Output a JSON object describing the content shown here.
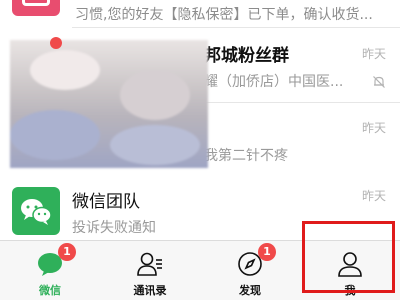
{
  "chats": [
    {
      "title": "",
      "preview": "习惯,您的好友【隐私保密】已下单，确认收货...",
      "time": ""
    },
    {
      "title": "邦城粉丝群",
      "preview": "耀（加侨店）中国医...",
      "time": "昨天",
      "muted": true,
      "icon": "mute-bell-icon"
    },
    {
      "title": "",
      "preview": "我第二针不疼",
      "time": "昨天"
    },
    {
      "title": "微信团队",
      "preview": "投诉失败通知",
      "time": "昨天",
      "icon": "wechat-team-icon"
    }
  ],
  "tabs": [
    {
      "label": "微信",
      "badge": "1",
      "icon": "chat-bubble-icon",
      "active": true
    },
    {
      "label": "通讯录",
      "badge": "",
      "icon": "contacts-icon",
      "active": false
    },
    {
      "label": "发现",
      "badge": "1",
      "icon": "compass-icon",
      "active": false
    },
    {
      "label": "我",
      "badge": "",
      "icon": "person-icon",
      "active": false
    }
  ],
  "colors": {
    "accent": "#2fb05a",
    "badge": "#f04a4a",
    "highlight": "#e01b1b"
  }
}
